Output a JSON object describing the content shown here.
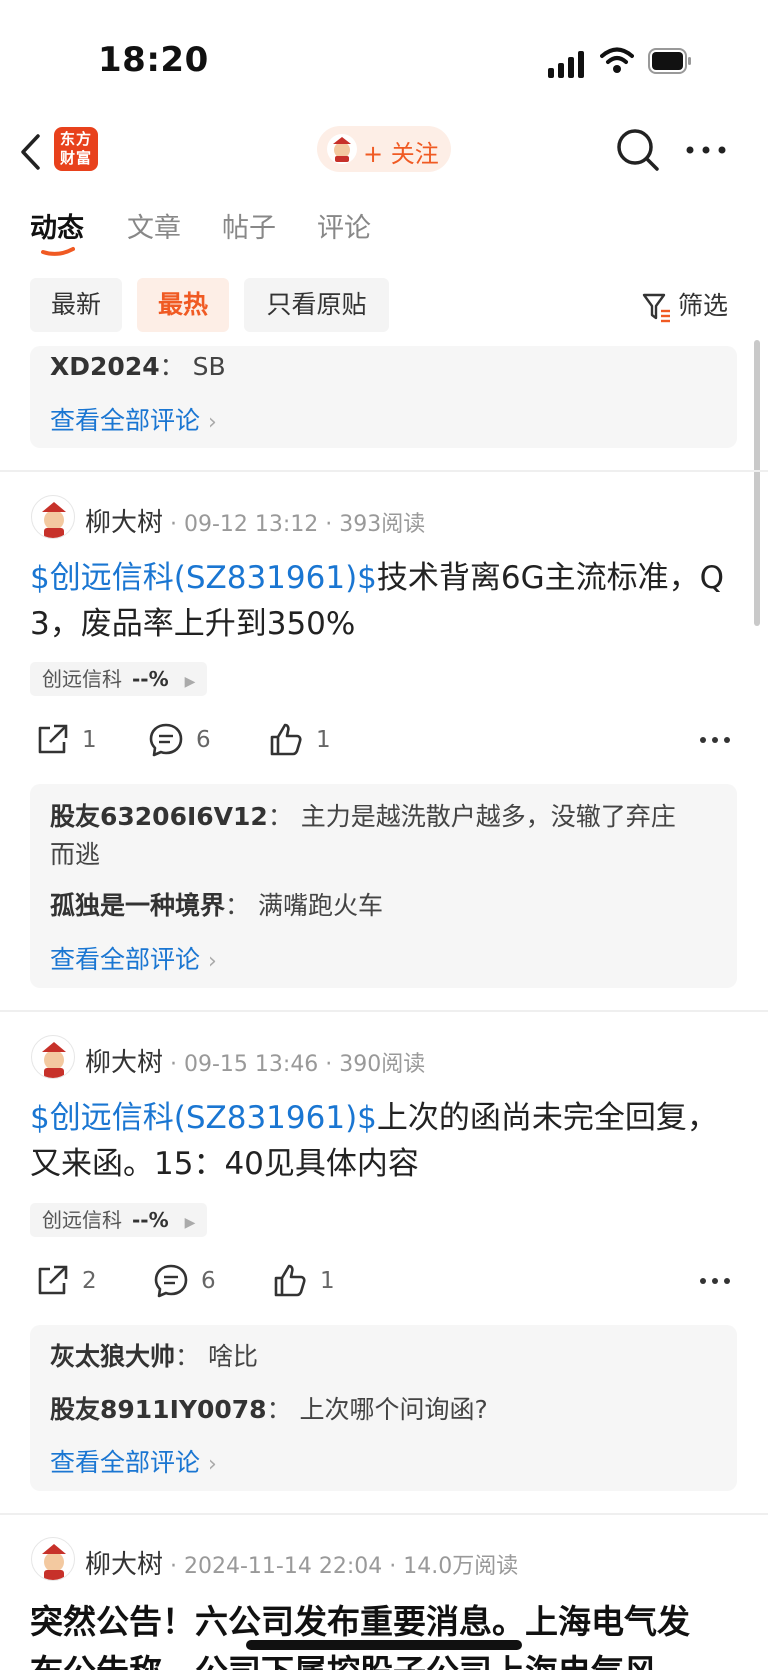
{
  "status_bar": {
    "time": "18:20"
  },
  "nav": {
    "logo_text": "东方财富",
    "follow_label": "+ 关注"
  },
  "tabs": [
    {
      "label": "动态",
      "active": true
    },
    {
      "label": "文章",
      "active": false
    },
    {
      "label": "帖子",
      "active": false
    },
    {
      "label": "评论",
      "active": false
    }
  ],
  "filters": {
    "chips": [
      "最新",
      "最热",
      "只看原贴"
    ],
    "active": "最热",
    "filter_label": "筛选"
  },
  "top_comments": {
    "items": [
      {
        "user": "XD2024",
        "sep": "：",
        "text": "SB"
      }
    ],
    "view_all": "查看全部评论"
  },
  "posts": [
    {
      "author": "柳大树",
      "meta": "· 09-12 13:12 · 393阅读",
      "stock": "$创远信科(SZ831961)$",
      "text_line1": "技术背离6G主流标准，Q",
      "text_line2": "3，废品率上升到350%",
      "tag": {
        "name": "创远信科",
        "pct": "--%"
      },
      "actions": {
        "share": "1",
        "comment": "6",
        "like": "1"
      },
      "comments": [
        {
          "user": "股友63206I6V12",
          "sep": "：",
          "text": "主力是越洗散户越多，没辙了弃庄",
          "text_cont": "而逃"
        },
        {
          "user": "孤独是一种境界",
          "sep": "：",
          "text": "满嘴跑火车"
        }
      ],
      "view_all": "查看全部评论"
    },
    {
      "author": "柳大树",
      "meta": "· 09-15 13:46 · 390阅读",
      "stock": "$创远信科(SZ831961)$",
      "text_line1": "上次的函尚未完全回复，",
      "text_line2": "又来函。15：40见具体内容",
      "tag": {
        "name": "创远信科",
        "pct": "--%"
      },
      "actions": {
        "share": "2",
        "comment": "6",
        "like": "1"
      },
      "comments": [
        {
          "user": "灰太狼大帅",
          "sep": "：",
          "text": "啥比"
        },
        {
          "user": "股友8911IY0078",
          "sep": "：",
          "text": "上次哪个问询函?"
        }
      ],
      "view_all": "查看全部评论"
    },
    {
      "author": "柳大树",
      "meta": "· 2024-11-14 22:04 · 14.0万阅读",
      "title_line1": "突然公告！六公司发布重要消息。上海电气发",
      "title_line2": "布公告称，公司下属控股子公司上海电气风"
    }
  ],
  "colors": {
    "accent": "#f05a23",
    "link": "#1a76d2",
    "logo_bg": "#e8411c"
  }
}
